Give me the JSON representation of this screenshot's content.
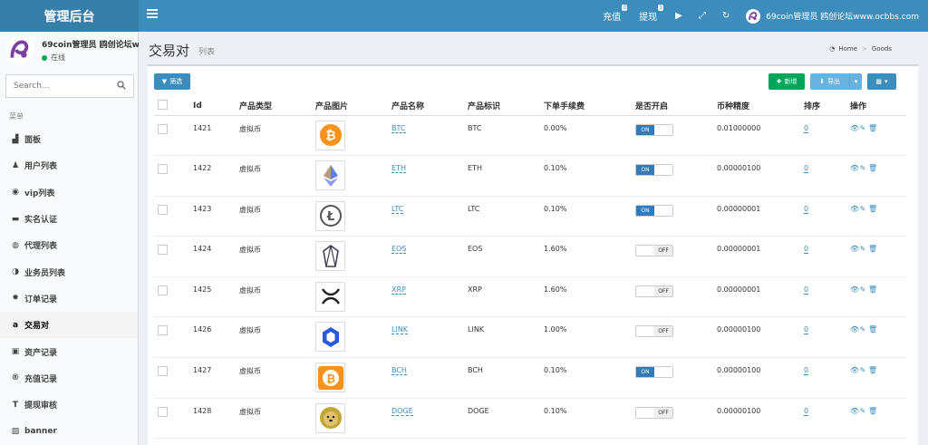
{
  "header": {
    "logo": "管理后台",
    "links": [
      {
        "label": "充值",
        "badge": "0"
      },
      {
        "label": "提现",
        "badge": "1"
      }
    ],
    "icons": [
      "play-icon",
      "expand-icon",
      "refresh-icon"
    ],
    "user_name": "69coin管理员 鸥创论坛www.ocbbs.com"
  },
  "sidebar": {
    "user_name": "69coin管理员 鸥创论坛www.ocbbs.com",
    "status": "在线",
    "search_placeholder": "Search...",
    "menu_header": "菜单",
    "items": [
      {
        "label": "面板",
        "icon": "chart-icon"
      },
      {
        "label": "用户列表",
        "icon": "user-icon"
      },
      {
        "label": "vip列表",
        "icon": "vip-icon"
      },
      {
        "label": "实名认证",
        "icon": "card-icon"
      },
      {
        "label": "代理列表",
        "icon": "agent-icon"
      },
      {
        "label": "业务员列表",
        "icon": "half-circle-icon"
      },
      {
        "label": "订单记录",
        "icon": "gear-icon"
      },
      {
        "label": "交易对",
        "icon": "amazon-icon",
        "active": true
      },
      {
        "label": "资产记录",
        "icon": "money-icon"
      },
      {
        "label": "充值记录",
        "icon": "registered-icon"
      },
      {
        "label": "提现审核",
        "icon": "text-height-icon"
      },
      {
        "label": "banner",
        "icon": "image-icon"
      }
    ]
  },
  "page": {
    "title": "交易对",
    "subtitle": "列表",
    "breadcrumb": [
      "Home",
      "Goods"
    ]
  },
  "toolbar": {
    "filter_label": "筛选",
    "new_label": "新增",
    "export_label": "导出"
  },
  "table": {
    "headers": [
      "Id",
      "产品类型",
      "产品图片",
      "产品名称",
      "产品标识",
      "下单手续费",
      "是否开启",
      "币种精度",
      "排序",
      "操作"
    ],
    "rows": [
      {
        "id": "1421",
        "type": "虚拟币",
        "name": "BTC",
        "symbol": "BTC",
        "fee": "0.00%",
        "switch_label": "ON",
        "enabled": true,
        "precision": "0.01000000",
        "sort": "0",
        "coin": "btc",
        "color": "#f7931a"
      },
      {
        "id": "1422",
        "type": "虚拟币",
        "name": "ETH",
        "symbol": "ETH",
        "fee": "0.10%",
        "switch_label": "ON",
        "enabled": true,
        "precision": "0.00000100",
        "sort": "0",
        "coin": "eth",
        "color": "#627eea"
      },
      {
        "id": "1423",
        "type": "虚拟币",
        "name": "LTC",
        "symbol": "LTC",
        "fee": "0.10%",
        "switch_label": "ON",
        "enabled": true,
        "precision": "0.00000001",
        "sort": "0",
        "coin": "ltc",
        "color": "#555555"
      },
      {
        "id": "1424",
        "type": "虚拟币",
        "name": "EOS",
        "symbol": "EOS",
        "fee": "1.60%",
        "switch_label": "OFF",
        "enabled": false,
        "precision": "0.00000001",
        "sort": "0",
        "coin": "eos",
        "color": "#443f54"
      },
      {
        "id": "1425",
        "type": "虚拟币",
        "name": "XRP",
        "symbol": "XRP",
        "fee": "1.60%",
        "switch_label": "OFF",
        "enabled": false,
        "precision": "0.00000001",
        "sort": "0",
        "coin": "xrp",
        "color": "#222222"
      },
      {
        "id": "1426",
        "type": "虚拟币",
        "name": "LINK",
        "symbol": "LINK",
        "fee": "1.00%",
        "switch_label": "OFF",
        "enabled": false,
        "precision": "0.00000100",
        "sort": "0",
        "coin": "link",
        "color": "#2a5ada"
      },
      {
        "id": "1427",
        "type": "虚拟币",
        "name": "BCH",
        "symbol": "BCH",
        "fee": "0.10%",
        "switch_label": "ON",
        "enabled": true,
        "precision": "0.00000100",
        "sort": "0",
        "coin": "bch",
        "color": "#f7931a"
      },
      {
        "id": "1428",
        "type": "虚拟币",
        "name": "DOGE",
        "symbol": "DOGE",
        "fee": "0.10%",
        "switch_label": "OFF",
        "enabled": false,
        "precision": "0.00000100",
        "sort": "0",
        "coin": "doge",
        "color": "#c2a633"
      }
    ]
  },
  "colors": {
    "topbar": "#3c8dbc",
    "logo_bg": "#367fa9",
    "success": "#00a65a",
    "primary": "#337ab7"
  }
}
